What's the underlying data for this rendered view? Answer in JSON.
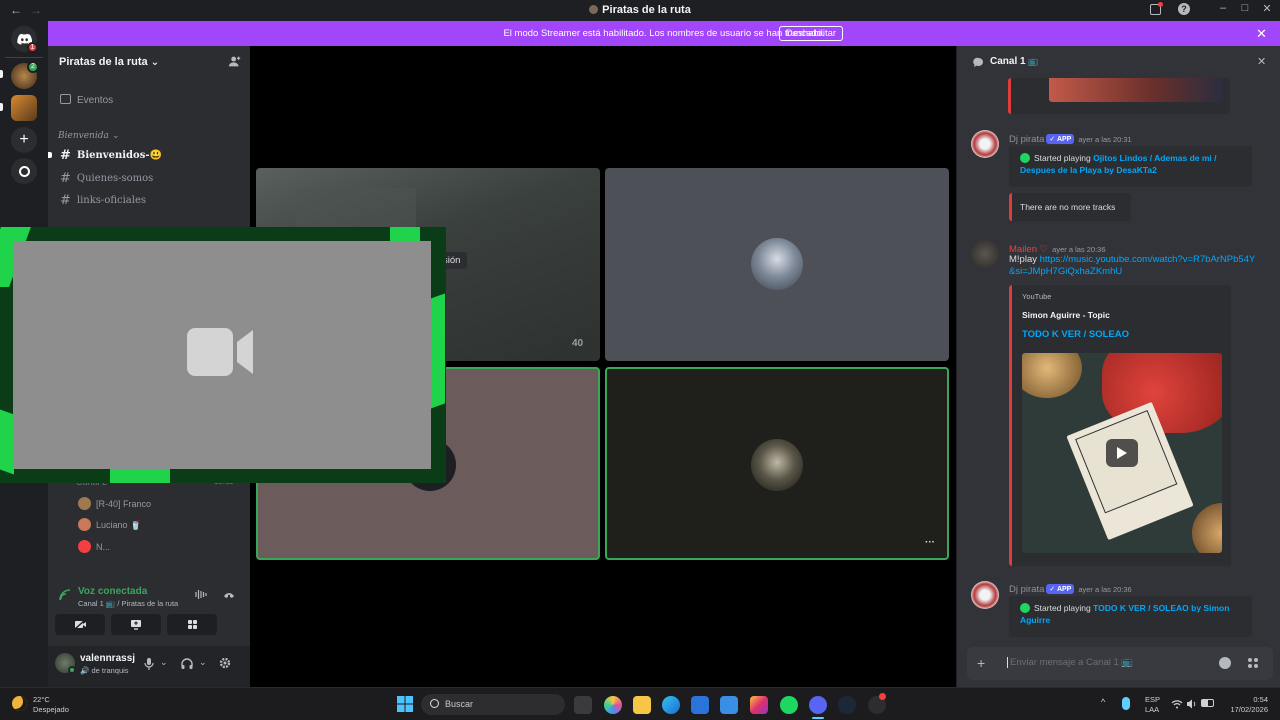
{
  "window": {
    "title": "Piratas de la ruta",
    "back_glyph": "←",
    "forward_glyph": "→",
    "min_glyph": "–",
    "max_glyph": "□",
    "close_glyph": "✕",
    "help_glyph": "?"
  },
  "streamer_bar": {
    "message": "El modo Streamer está habilitado. Los nombres de usuario se han truncado.",
    "button_label": "Deshabilitar",
    "close_glyph": "✕",
    "accent": "#a146fa"
  },
  "rail": {
    "home_badge": "1",
    "server_badge": "2"
  },
  "sidebar": {
    "guild_name": "Piratas de la ruta",
    "guild_chevron": "⌄",
    "events_label": "Eventos",
    "category_label": "Bienvenida",
    "channels": [
      {
        "label": "Bienvenidos-😃"
      },
      {
        "label": "Quienes-somos"
      },
      {
        "label": "links-oficiales"
      }
    ],
    "voice_channel_label": "Canal 2",
    "voice_channel_time": "12:11",
    "voice_members": [
      {
        "label": "[R-40] Franco"
      },
      {
        "label": "Luciano 🥤"
      },
      {
        "label": "N..."
      }
    ],
    "voice_status": "Voz conectada",
    "voice_location": "Canal 1 📺 / Piratas de la ruta",
    "user": {
      "name": "valennrassj",
      "status": "de tranquis"
    }
  },
  "stage": {
    "partial_label": "sión",
    "tile_counter": "40",
    "more_glyph": "···",
    "speaking_color": "#3ba55c"
  },
  "chat": {
    "channel_name": "Canal 1",
    "messages": [
      {
        "author": "Dj pirata",
        "bot_tag": "APP",
        "time": "ayer a las 20:31",
        "embed_prefix": "Started playing",
        "embed_link": "Ojitos Lindos / Ademas de mi / Despues de la Playa by DesaKTa2",
        "author_color": "#8e9297"
      },
      {
        "embed_text": "There are no more tracks"
      },
      {
        "author": "Mailen ♡",
        "time": "ayer a las 20:36",
        "text": "M!play",
        "link": "https://music.youtube.com/watch?v=R7bArNPb54Y&si=JMpH7GiQxhaZKmhU",
        "author_color": "#f23f43",
        "embed_provider": "YouTube",
        "embed_author": "Simon Aguirre - Topic",
        "embed_title": "TODO K VER / SOLEAO"
      },
      {
        "author": "Dj pirata",
        "bot_tag": "APP",
        "time": "ayer a las 20:36",
        "embed_prefix": "Started playing",
        "embed_link": "TODO K VER / SOLEAO by Simon Aguirre",
        "author_color": "#8e9297"
      }
    ],
    "input_placeholder": "Enviar mensaje a Canal 1 📺",
    "add_glyph": "+",
    "close_glyph": "✕"
  },
  "taskbar": {
    "weather_temp": "22°C",
    "weather_desc": "Despejado",
    "search_placeholder": "Buscar",
    "lang_top": "ESP",
    "lang_bottom": "LAA",
    "clock_time": "0:54",
    "clock_date": "17/02/2026"
  }
}
